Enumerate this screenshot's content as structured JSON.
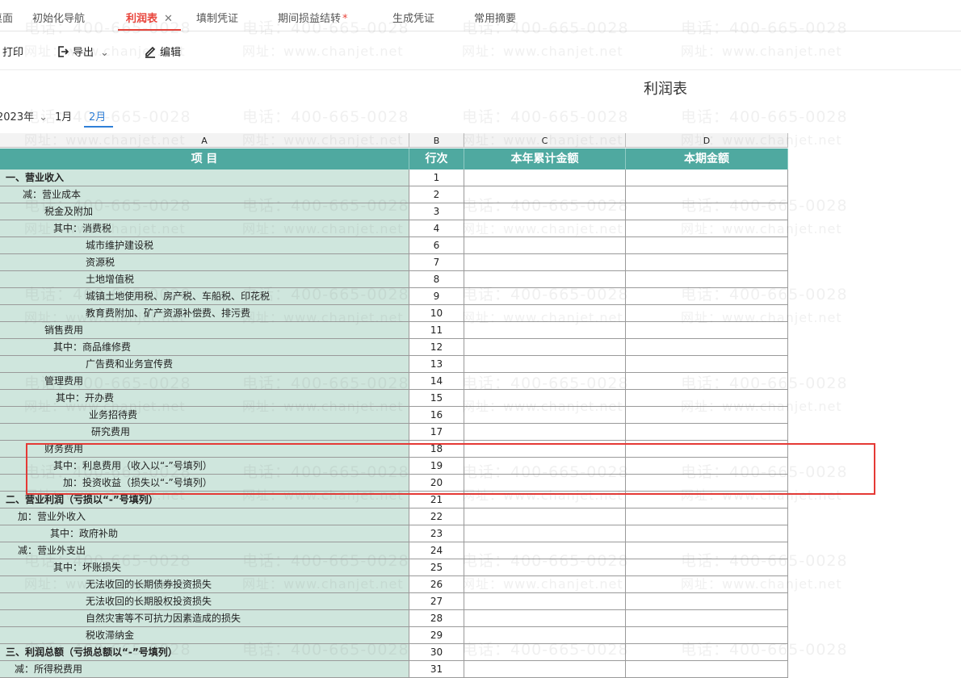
{
  "tabs": [
    {
      "label": "桌面",
      "active": false,
      "closable": false,
      "modified": false
    },
    {
      "label": "初始化导航",
      "active": false,
      "closable": false,
      "modified": false
    },
    {
      "label": "利润表",
      "active": true,
      "closable": true,
      "modified": false
    },
    {
      "label": "填制凭证",
      "active": false,
      "closable": false,
      "modified": false
    },
    {
      "label": "期间损益结转",
      "active": false,
      "closable": false,
      "modified": true
    },
    {
      "label": "生成凭证",
      "active": false,
      "closable": false,
      "modified": false
    },
    {
      "label": "常用摘要",
      "active": false,
      "closable": false,
      "modified": false
    }
  ],
  "toolbar": {
    "print": "打印",
    "export": "导出",
    "edit": "编辑"
  },
  "report_title": "利润表",
  "period": {
    "year": "2023年",
    "months": [
      "1月",
      "2月"
    ],
    "selected": "2月"
  },
  "columns": [
    "A",
    "B",
    "C",
    "D"
  ],
  "header": {
    "item": "项  目",
    "row_no": "行次",
    "ytd": "本年累计金额",
    "current": "本期金额"
  },
  "rows": [
    {
      "label": "一、营业收入",
      "no": "1"
    },
    {
      "label": "减：营业成本",
      "no": "2"
    },
    {
      "label": "税金及附加",
      "no": "3"
    },
    {
      "label": "其中：消费税",
      "no": "4"
    },
    {
      "label": "城市维护建设税",
      "no": "6"
    },
    {
      "label": "资源税",
      "no": "7"
    },
    {
      "label": "土地增值税",
      "no": "8"
    },
    {
      "label": "城镇土地使用税、房产税、车船税、印花税",
      "no": "9"
    },
    {
      "label": "教育费附加、矿产资源补偿费、排污费",
      "no": "10"
    },
    {
      "label": "销售费用",
      "no": "11"
    },
    {
      "label": "其中：商品维修费",
      "no": "12"
    },
    {
      "label": "广告费和业务宣传费",
      "no": "13"
    },
    {
      "label": "管理费用",
      "no": "14"
    },
    {
      "label": "其中：开办费",
      "no": "15"
    },
    {
      "label": "业务招待费",
      "no": "16"
    },
    {
      "label": "研究费用",
      "no": "17"
    },
    {
      "label": "财务费用",
      "no": "18"
    },
    {
      "label": "其中：利息费用（收入以“-”号填列）",
      "no": "19"
    },
    {
      "label": "加：投资收益（损失以“-”号填列）",
      "no": "20"
    },
    {
      "label": "二、营业利润（亏损以“-”号填列）",
      "no": "21"
    },
    {
      "label": "加：营业外收入",
      "no": "22"
    },
    {
      "label": "其中：政府补助",
      "no": "23"
    },
    {
      "label": "减：营业外支出",
      "no": "24"
    },
    {
      "label": "其中：坏账损失",
      "no": "25"
    },
    {
      "label": "无法收回的长期债券投资损失",
      "no": "26"
    },
    {
      "label": "无法收回的长期股权投资损失",
      "no": "27"
    },
    {
      "label": "自然灾害等不可抗力因素造成的损失",
      "no": "28"
    },
    {
      "label": "税收滞纳金",
      "no": "29"
    },
    {
      "label": "三、利润总额（亏损总额以“-”号填列）",
      "no": "30"
    },
    {
      "label": "减：所得税费用",
      "no": "31"
    }
  ],
  "watermark": {
    "phone": "电话：400-665-0028",
    "site": "网址：www.chanjet.net"
  }
}
